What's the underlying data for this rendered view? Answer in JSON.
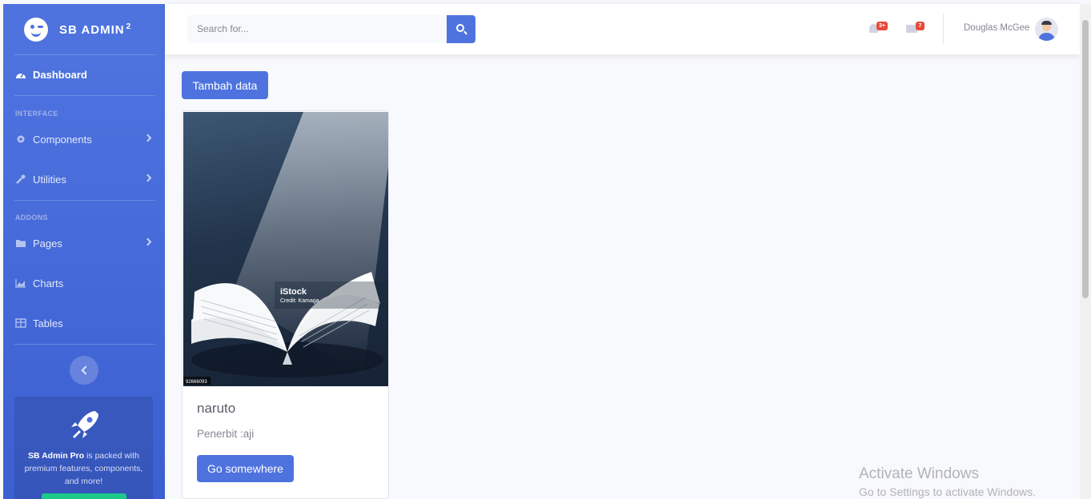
{
  "brand": {
    "name": "SB ADMIN",
    "superscript": "2"
  },
  "sidebar": {
    "dashboard": "Dashboard",
    "heading_interface": "INTERFACE",
    "components": "Components",
    "utilities": "Utilities",
    "heading_addons": "ADDONS",
    "pages": "Pages",
    "charts": "Charts",
    "tables": "Tables",
    "promo": {
      "bold": "SB Admin Pro",
      "text": " is packed with premium features, components, and more!"
    }
  },
  "topbar": {
    "search_placeholder": "Search for...",
    "alerts_badge": "3+",
    "messages_badge": "7",
    "user_name": "Douglas McGee"
  },
  "content": {
    "add_button": "Tambah data",
    "card": {
      "image_watermark": "iStock",
      "image_credit": "Credit: Kamaga",
      "image_id": "92666093",
      "title": "naruto",
      "text": "Penerbit :aji",
      "button": "Go somewhere"
    }
  },
  "watermark": {
    "title": "Activate Windows",
    "subtitle": "Go to Settings to activate Windows."
  },
  "colors": {
    "primary": "#4e73df",
    "success": "#1cc88a",
    "danger": "#e74a3b",
    "background": "#f8f9fc"
  }
}
